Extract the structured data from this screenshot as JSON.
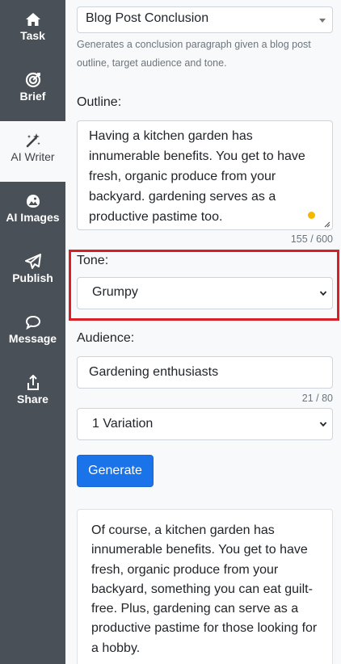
{
  "sidebar": {
    "items": [
      {
        "label": "Task",
        "icon": "home-icon"
      },
      {
        "label": "Brief",
        "icon": "target-icon"
      },
      {
        "label": "AI Writer",
        "icon": "magic-wand-icon"
      },
      {
        "label": "AI Images",
        "icon": "image-icon"
      },
      {
        "label": "Publish",
        "icon": "send-icon"
      },
      {
        "label": "Message",
        "icon": "chat-icon"
      },
      {
        "label": "Share",
        "icon": "share-icon"
      }
    ],
    "active": "AI Writer"
  },
  "template_select": {
    "value": "Blog Post Conclusion",
    "hint": "Generates a conclusion paragraph given a blog post outline, target audience and tone."
  },
  "outline": {
    "label": "Outline:",
    "value": "Having a kitchen garden has innumerable benefits. You get to have fresh, organic produce from your backyard. gardening serves as a productive pastime too.",
    "counter": "155 / 600"
  },
  "tone": {
    "label": "Tone:",
    "value": "Grumpy"
  },
  "audience": {
    "label": "Audience:",
    "value": "Gardening enthusiasts",
    "counter": "21 / 80"
  },
  "variations": {
    "value": "1 Variation"
  },
  "generate_button": "Generate",
  "output": {
    "text": "Of course, a kitchen garden has innumerable benefits. You get to have fresh, organic produce from your backyard, something you can eat guilt-free. Plus, gardening can serve as a productive pastime for those looking for a hobby."
  },
  "colors": {
    "sidebar_bg": "#495057",
    "primary": "#1a73e8",
    "highlight": "#d91f26",
    "status_dot": "#f5b800"
  }
}
